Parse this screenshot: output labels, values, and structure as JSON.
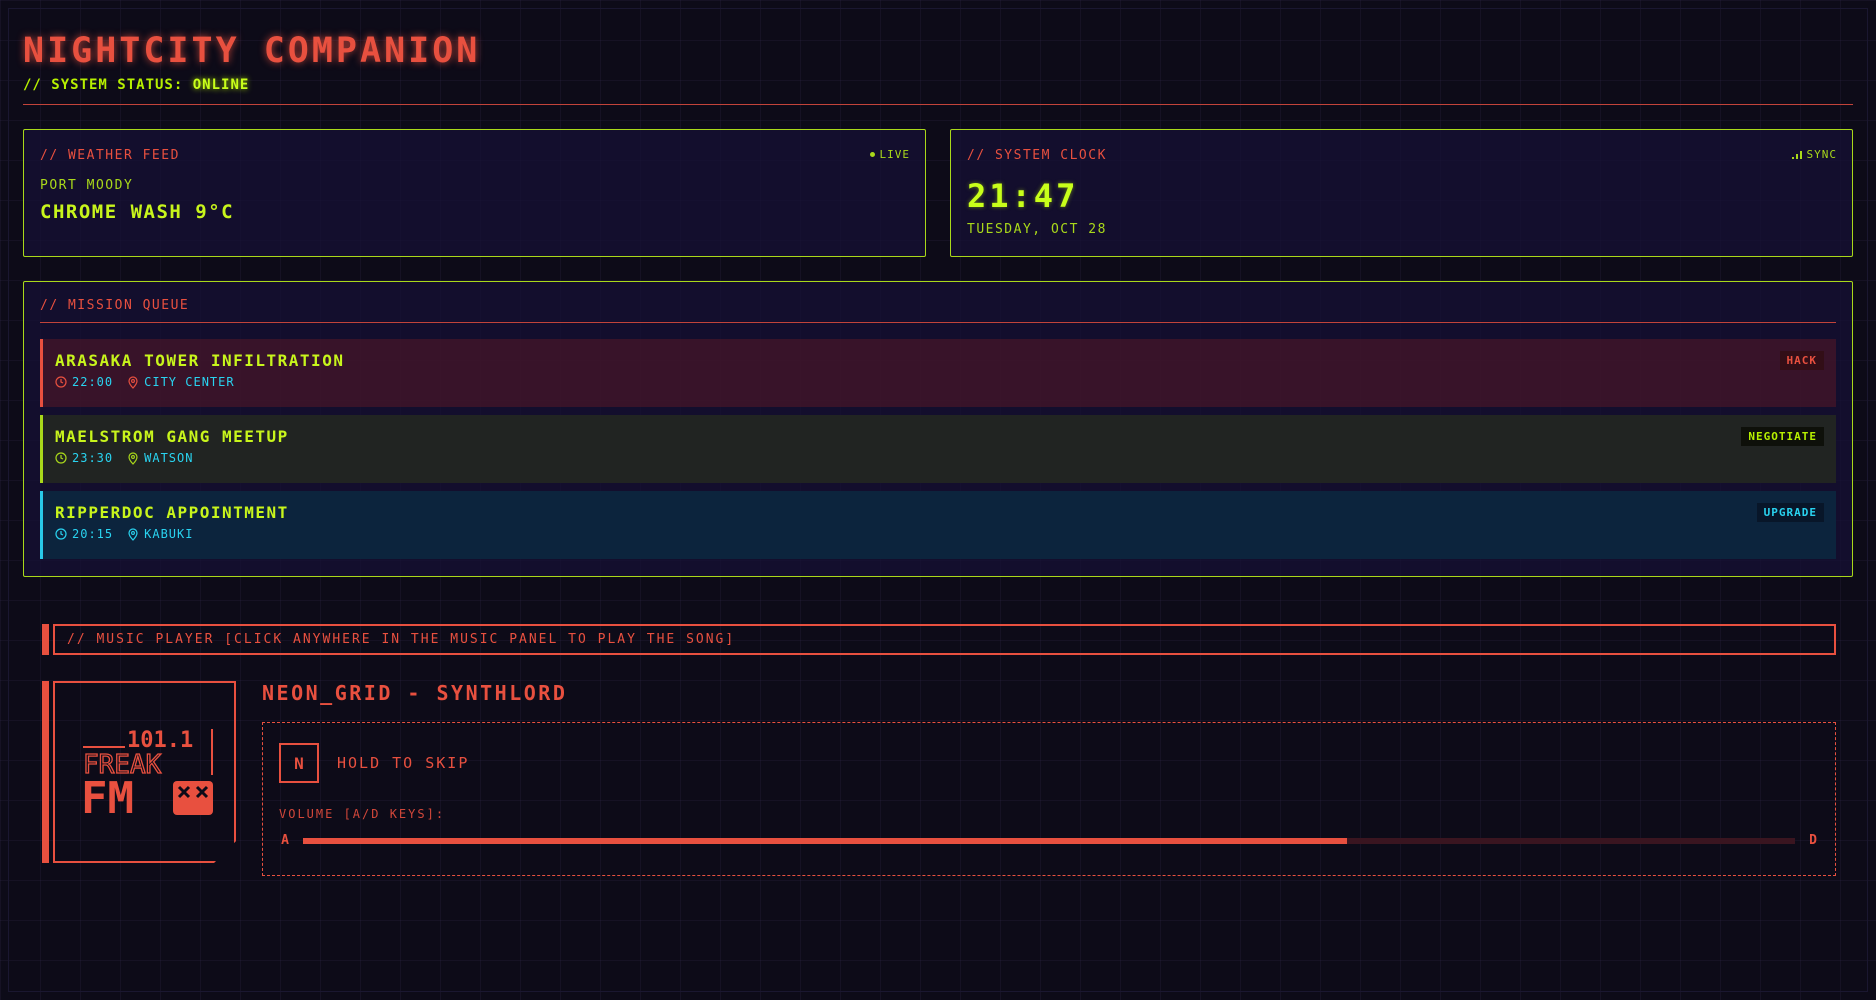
{
  "app": {
    "title": "NIGHTCITY COMPANION",
    "status_prefix": "// SYSTEM STATUS:",
    "status_value": "ONLINE"
  },
  "weather": {
    "label": "// WEATHER FEED",
    "flag": "LIVE",
    "location": "PORT MOODY",
    "condition": "CHROME WASH 9°C"
  },
  "clock": {
    "label": "// SYSTEM CLOCK",
    "flag": "SYNC",
    "time": "21:47",
    "date": "TUESDAY, OCT 28"
  },
  "missions": {
    "label": "// MISSION QUEUE",
    "items": [
      {
        "title": "ARASAKA TOWER INFILTRATION",
        "time": "22:00",
        "location": "CITY CENTER",
        "tag": "HACK"
      },
      {
        "title": "MAELSTROM GANG MEETUP",
        "time": "23:30",
        "location": "WATSON",
        "tag": "NEGOTIATE"
      },
      {
        "title": "RIPPERDOC APPOINTMENT",
        "time": "20:15",
        "location": "KABUKI",
        "tag": "UPGRADE"
      }
    ]
  },
  "music": {
    "header": "// MUSIC PLAYER [CLICK ANYWHERE IN THE MUSIC PANEL TO PLAY THE SONG]",
    "song": "NEON_GRID - SYNTHLORD",
    "skip_key": "N",
    "skip_label": "HOLD TO SKIP",
    "volume_label": "VOLUME [A/D KEYS]:",
    "volume_left_key": "A",
    "volume_right_key": "D",
    "volume_level": 0.7,
    "station_logo": {
      "frequency": "101.1",
      "line1": "FREAK",
      "line2": "FM"
    }
  },
  "colors": {
    "accent_red": "#e8503f",
    "accent_green": "#b7f000",
    "accent_cyan": "#29d3f0",
    "background": "#0d0b18"
  }
}
